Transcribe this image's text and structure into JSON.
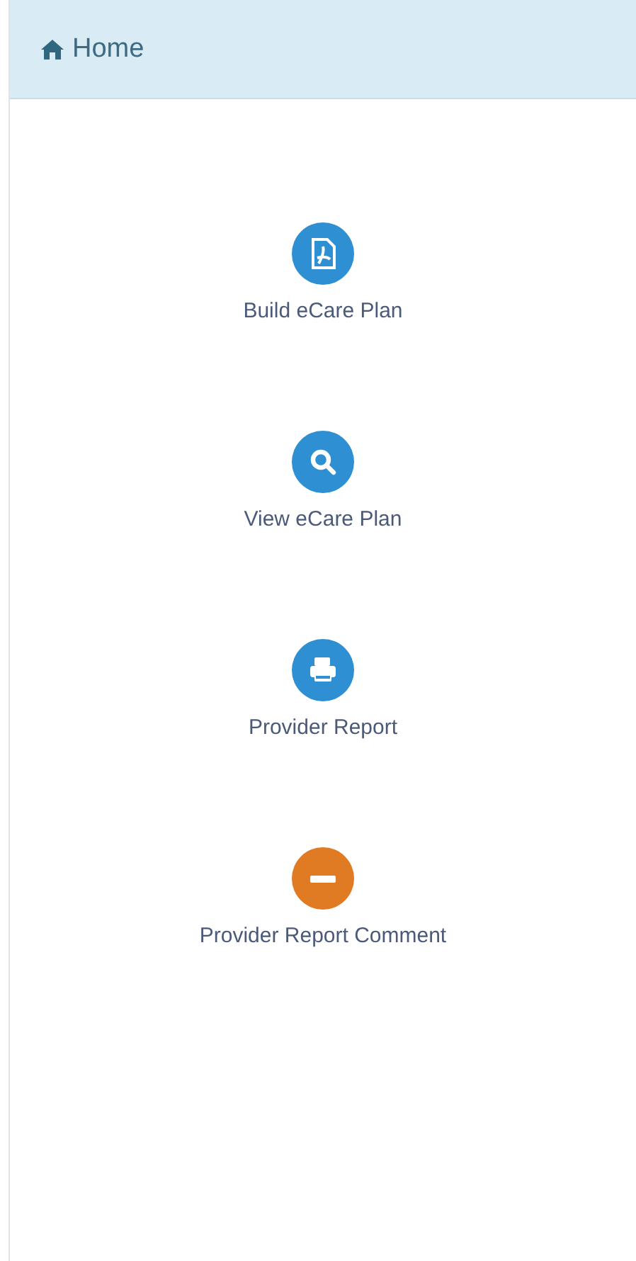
{
  "header": {
    "title": "Home"
  },
  "actions": [
    {
      "label": "Build eCare Plan",
      "kind": "pdf",
      "color": "#2e8fd3"
    },
    {
      "label": "View eCare Plan",
      "kind": "search",
      "color": "#2e8fd3"
    },
    {
      "label": "Provider Report",
      "kind": "print",
      "color": "#2e8fd3"
    },
    {
      "label": "Provider Report Comment",
      "kind": "minus",
      "color": "#e07b24"
    }
  ]
}
